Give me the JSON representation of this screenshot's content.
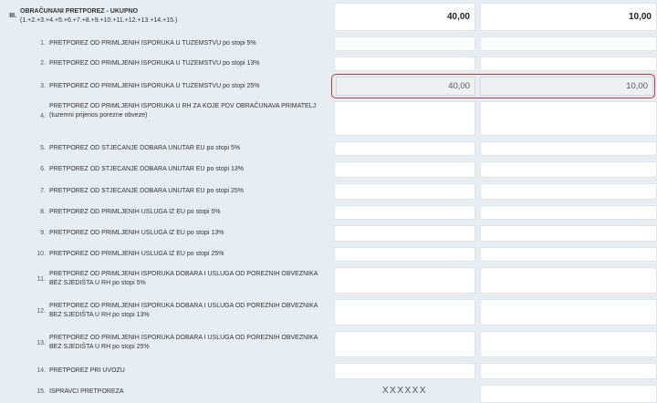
{
  "header": {
    "number": "III.",
    "title": "OBRAČUNANI PRETPOREZ - UKUPNO",
    "formula": "(1.+2.+3.+4.+5.+6.+7.+8.+9.+10.+11.+12.+13.+14.+15.)",
    "value1": "40,00",
    "value2": "10,00"
  },
  "rows": [
    {
      "num": "1.",
      "label": "PRETPOREZ OD PRIMLJENIH ISPORUKA U TUZEMSTVU po stopi 5%",
      "v1": "",
      "v2": ""
    },
    {
      "num": "2.",
      "label": "PRETPOREZ OD PRIMLJENIH ISPORUKA U TUZEMSTVU po stopi 13%",
      "v1": "",
      "v2": ""
    },
    {
      "num": "3.",
      "label": "PRETPOREZ OD PRIMLJENIH ISPORUKA U TUZEMSTVU po stopi 25%",
      "v1": "40,00",
      "v2": "10,00"
    },
    {
      "num": "4.",
      "label": "PRETPOREZ OD PRIMLJENIH ISPORUKA U RH ZA KOJE PDV OBRAČUNAVA PRIMATELJ",
      "sub": "(tuzemni prijenos porezne obveze)",
      "v1": "",
      "v2": ""
    },
    {
      "num": "5.",
      "label": "PRETPOREZ OD STJECANJE DOBARA UNUTAR EU po stopi 5%",
      "v1": "",
      "v2": ""
    },
    {
      "num": "6.",
      "label": "PRETPOREZ OD STJECANJE DOBARA UNUTAR EU po stopi 13%",
      "v1": "",
      "v2": ""
    },
    {
      "num": "7.",
      "label": "PRETPOREZ OD STJECANJE DOBARA UNUTAR EU po stopi 25%",
      "v1": "",
      "v2": ""
    },
    {
      "num": "8.",
      "label": "PRETPOREZ OD PRIMLJENIH USLUGA IZ EU po stopi 5%",
      "v1": "",
      "v2": ""
    },
    {
      "num": "9.",
      "label": "PRETPOREZ OD PRIMLJENIH USLUGA IZ EU po stopi 13%",
      "v1": "",
      "v2": ""
    },
    {
      "num": "10.",
      "label": "PRETPOREZ OD PRIMLJENIH USLUGA IZ EU po stopi 25%",
      "v1": "",
      "v2": ""
    },
    {
      "num": "11.",
      "label": "PRETPOREZ OD PRIMLJENIH ISPORUKA DOBARA I USLUGA OD POREZNIH OBVEZNIKA BEZ SJEDIŠTA U RH po stopi 5%",
      "v1": "",
      "v2": ""
    },
    {
      "num": "12.",
      "label": "PRETPOREZ OD PRIMLJENIH ISPORUKA DOBARA I USLUGA OD POREZNIH OBVEZNIKA BEZ SJEDIŠTA U RH po stopi 13%",
      "v1": "",
      "v2": ""
    },
    {
      "num": "13.",
      "label": "PRETPOREZ OD PRIMLJENIH ISPORUKA DOBARA I USLUGA OD POREZNIH OBVEZNIKA BEZ SJEDIŠTA U RH po stopi 25%",
      "v1": "",
      "v2": ""
    },
    {
      "num": "14.",
      "label": "PRETPOREZ PRI UVOZU",
      "v1": "",
      "v2": ""
    },
    {
      "num": "15.",
      "label": "ISPRAVCI PRETPOREZA",
      "v1": "XXXXXX",
      "v2": ""
    }
  ],
  "colors": {
    "background": "#e6edf3",
    "highlight_border": "#d9342b"
  }
}
